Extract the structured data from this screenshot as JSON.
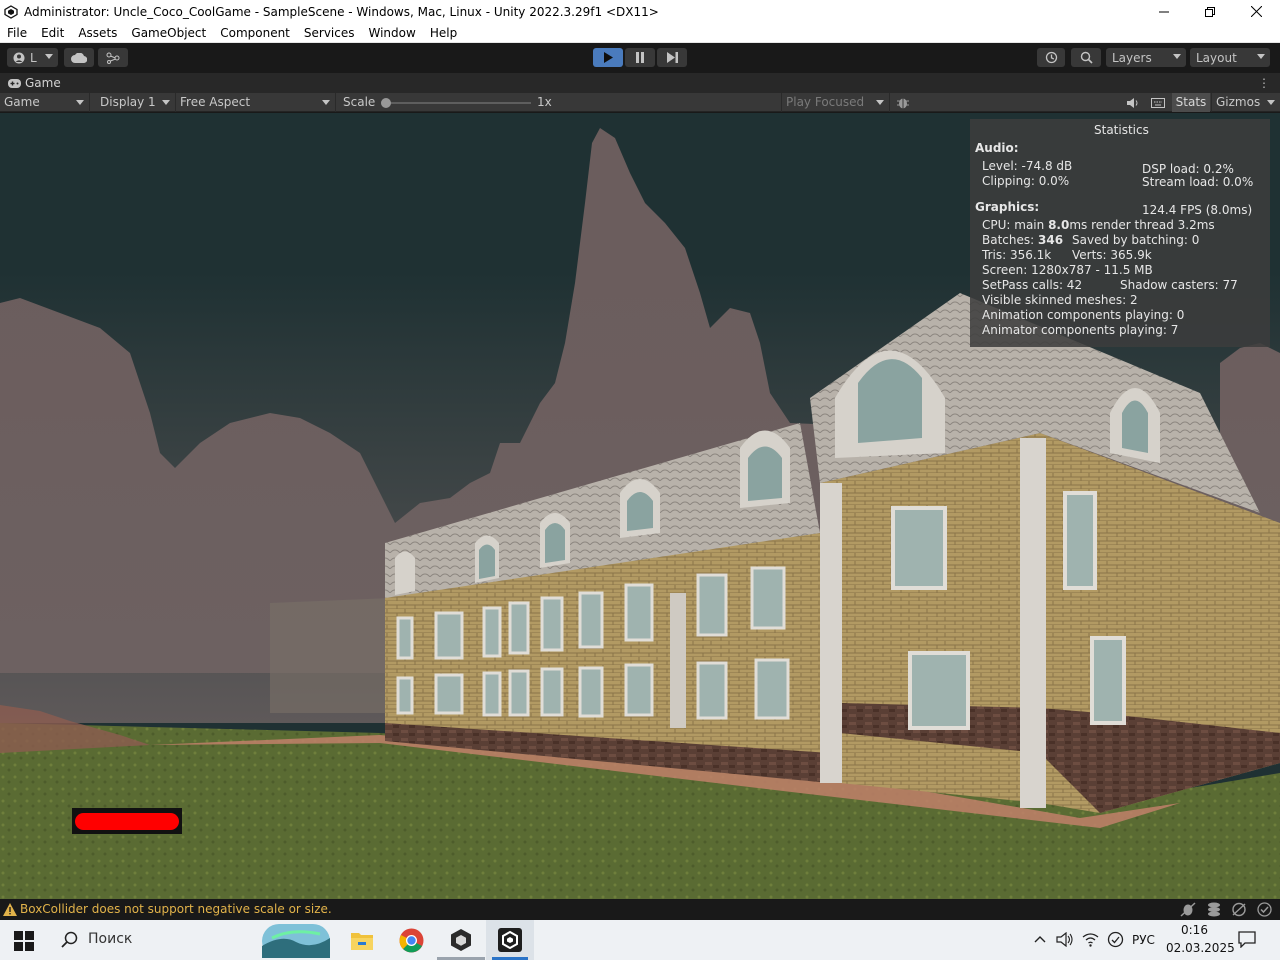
{
  "window": {
    "title": "Administrator: Uncle_Coco_CoolGame - SampleScene - Windows, Mac, Linux - Unity 2022.3.29f1 <DX11>"
  },
  "menu": [
    "File",
    "Edit",
    "Assets",
    "GameObject",
    "Component",
    "Services",
    "Window",
    "Help"
  ],
  "toolbar": {
    "account_label": "L",
    "layers_label": "Layers",
    "layout_label": "Layout"
  },
  "game_tab": {
    "label": "Game"
  },
  "game_bar": {
    "mode": "Game",
    "display": "Display 1",
    "aspect": "Free Aspect",
    "scale_label": "Scale",
    "scale_value": "1x",
    "scale_level": 0.0,
    "play_focused": "Play Focused",
    "stats": "Stats",
    "gizmos": "Gizmos"
  },
  "stats": {
    "title": "Statistics",
    "audio_header": "Audio:",
    "level": "Level: -74.8 dB",
    "clipping": "Clipping: 0.0%",
    "dsp_load": "DSP load: 0.2%",
    "stream_load": "Stream load: 0.0%",
    "graphics_header": "Graphics:",
    "fps": "124.4 FPS (8.0ms)",
    "cpu_prefix": "CPU: main ",
    "cpu_main": "8.0",
    "cpu_suffix": "ms  render thread 3.2ms",
    "batches_prefix": "Batches: ",
    "batches": "346",
    "saved_batching": "Saved by batching: 0",
    "tris": "Tris: 356.1k",
    "verts": "Verts: 365.9k",
    "screen": "Screen: 1280x787 - 11.5 MB",
    "setpass": "SetPass calls: 42",
    "shadow_casters": "Shadow casters: 77",
    "skinned_meshes": "Visible skinned meshes: 2",
    "animation_components": "Animation components playing: 0",
    "animator_components": "Animator components playing: 7"
  },
  "health": {
    "level": 1.0,
    "color": "#ff0000"
  },
  "status": {
    "warning": "BoxCollider does not support negative scale or size."
  },
  "taskbar": {
    "search_placeholder": "Поиск",
    "language": "РУС",
    "time": "0:16",
    "date": "02.03.2025"
  },
  "colors": {
    "play_active": "#4a7bbd",
    "sky": "#1f3133",
    "mountains": "#6b5d5d",
    "warning": "#e2b34a"
  }
}
